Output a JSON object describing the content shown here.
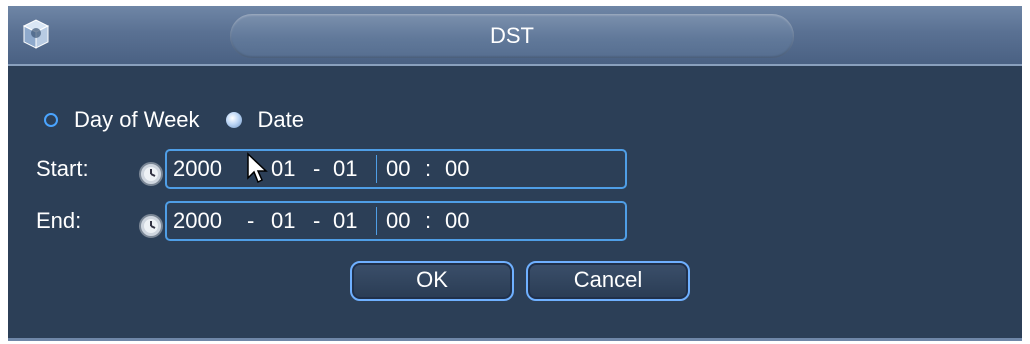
{
  "window": {
    "title": "DST"
  },
  "mode": {
    "options": [
      {
        "label": "Day of Week",
        "checked": false
      },
      {
        "label": "Date",
        "checked": true
      }
    ]
  },
  "start": {
    "label": "Start:",
    "year": "2000",
    "sep1": "-",
    "month": "01",
    "sep2": "-",
    "day": "01",
    "hour": "00",
    "colon": ":",
    "minute": "00"
  },
  "end": {
    "label": "End:",
    "year": "2000",
    "sep1": "-",
    "month": "01",
    "sep2": "-",
    "day": "01",
    "hour": "00",
    "colon": ":",
    "minute": "00"
  },
  "buttons": {
    "ok": "OK",
    "cancel": "Cancel"
  },
  "colors": {
    "panel": "#2c3f57",
    "title_bar": "#5a7193",
    "accent_blue": "#4f9ee6",
    "text": "#ffffff"
  },
  "icons": [
    "app-icon",
    "clock-icon",
    "mouse-cursor-icon"
  ]
}
